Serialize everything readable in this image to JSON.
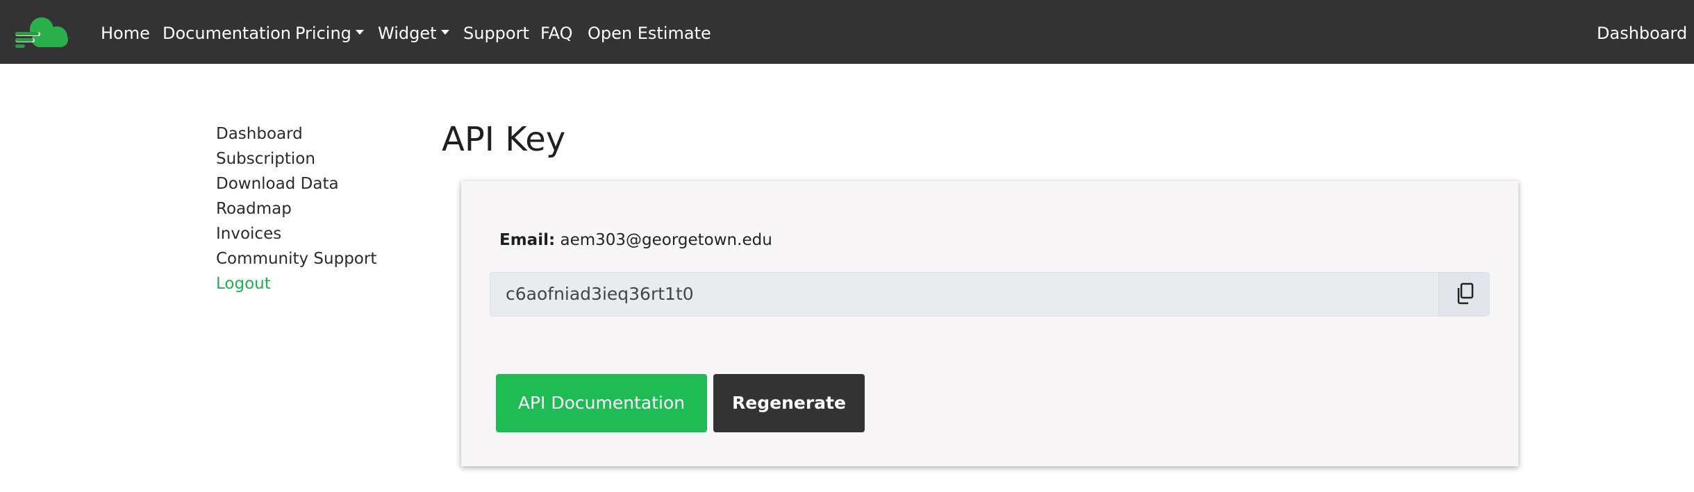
{
  "navbar": {
    "items": [
      {
        "label": "Home"
      },
      {
        "label": "Documentation"
      },
      {
        "label": "Pricing"
      },
      {
        "label": "Widget"
      },
      {
        "label": "Support"
      },
      {
        "label": "FAQ"
      },
      {
        "label": "Open Estimate"
      }
    ],
    "right_label": "Dashboard",
    "logo_colors": {
      "cloud": "#29b04a",
      "stripes": "#2a9a43"
    }
  },
  "sidebar": {
    "items": [
      {
        "label": "Dashboard"
      },
      {
        "label": "Subscription"
      },
      {
        "label": "Download Data"
      },
      {
        "label": "Roadmap"
      },
      {
        "label": "Invoices"
      },
      {
        "label": "Community Support"
      },
      {
        "label": "Logout"
      }
    ]
  },
  "page": {
    "title": "API Key"
  },
  "card": {
    "email_label": "Email:",
    "email_value": "aem303@georgetown.edu",
    "api_key": "c6aofniad3ieq36rt1t0",
    "copy_icon": "copy-icon",
    "docs_button": "API Documentation",
    "regenerate_button": "Regenerate"
  },
  "colors": {
    "navbar_bg": "#333333",
    "accent_green": "#1fbb55",
    "dark_button": "#333333"
  }
}
